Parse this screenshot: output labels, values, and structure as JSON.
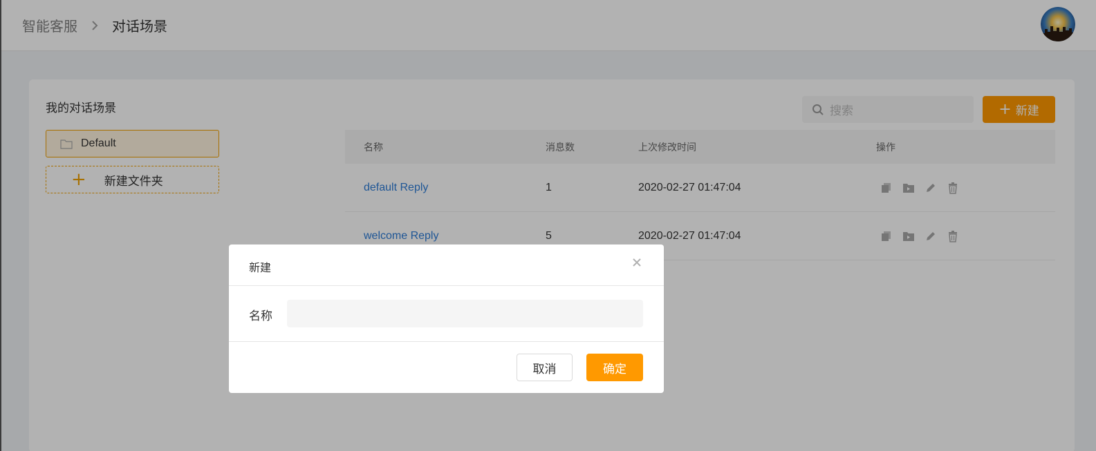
{
  "header": {
    "breadcrumb_root": "智能客服",
    "breadcrumb_current": "对话场景"
  },
  "sidebar": {
    "title": "我的对话场景",
    "folders": [
      {
        "label": "Default",
        "icon": "folder-icon"
      }
    ],
    "new_folder_label": "新建文件夹"
  },
  "toolbar": {
    "search_placeholder": "搜索",
    "new_button_label": "新建"
  },
  "table": {
    "columns": [
      "名称",
      "消息数",
      "上次修改时间",
      "操作"
    ],
    "rows": [
      {
        "name": "default Reply",
        "count": "1",
        "modified": "2020-02-27 01:47:04"
      },
      {
        "name": "welcome Reply",
        "count": "5",
        "modified": "2020-02-27 01:47:04"
      }
    ],
    "op_icons": [
      "copy-icon",
      "move-icon",
      "edit-icon",
      "delete-icon"
    ]
  },
  "modal": {
    "title": "新建",
    "field_label": "名称",
    "field_value": "",
    "field_placeholder": "",
    "cancel_label": "取消",
    "ok_label": "确定"
  },
  "colors": {
    "accent": "#ff9900",
    "link": "#2d7bd6",
    "overlay": "rgba(0,0,0,0.3)"
  }
}
